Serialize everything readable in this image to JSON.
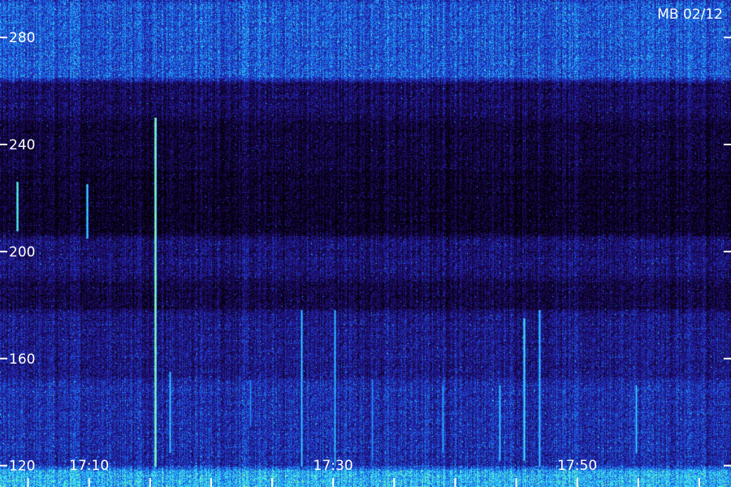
{
  "chart_data": {
    "type": "heatmap",
    "stamp": "MB 02/12",
    "y_axis": {
      "ticks": [
        120,
        160,
        200,
        240,
        280
      ],
      "range": [
        112,
        294
      ]
    },
    "x_axis": {
      "ticks": [
        "17:10",
        "17:30",
        "17:50"
      ],
      "tick_minutes": [
        10,
        30,
        50
      ],
      "range_minutes": [
        2.7,
        62.6
      ]
    },
    "colormap": [
      "#000000",
      "#14043a",
      "#22128a",
      "#1e3ed0",
      "#1a8ef0",
      "#3ee8f8",
      "#7cf7a0",
      "#f0f040"
    ],
    "bands": [
      {
        "from": 112,
        "to": 119,
        "level": 0.62
      },
      {
        "from": 119,
        "to": 152,
        "level": 0.36
      },
      {
        "from": 152,
        "to": 178,
        "level": 0.28
      },
      {
        "from": 178,
        "to": 190,
        "level": 0.16
      },
      {
        "from": 190,
        "to": 206,
        "level": 0.24
      },
      {
        "from": 206,
        "to": 230,
        "level": 0.09
      },
      {
        "from": 230,
        "to": 250,
        "level": 0.13
      },
      {
        "from": 250,
        "to": 264,
        "level": 0.2
      },
      {
        "from": 264,
        "to": 294,
        "level": 0.46
      }
    ],
    "bursts": [
      {
        "minute": 4.1,
        "from": 208,
        "to": 226,
        "level": 0.85
      },
      {
        "minute": 9.8,
        "from": 205,
        "to": 225,
        "level": 0.75
      },
      {
        "minute": 15.4,
        "from": 120,
        "to": 250,
        "level": 0.95
      },
      {
        "minute": 16.6,
        "from": 125,
        "to": 155,
        "level": 0.7
      },
      {
        "minute": 23.2,
        "from": 135,
        "to": 152,
        "level": 0.6
      },
      {
        "minute": 27.4,
        "from": 120,
        "to": 178,
        "level": 0.7
      },
      {
        "minute": 30.1,
        "from": 120,
        "to": 178,
        "level": 0.68
      },
      {
        "minute": 33.2,
        "from": 122,
        "to": 152,
        "level": 0.6
      },
      {
        "minute": 39.0,
        "from": 125,
        "to": 150,
        "level": 0.65
      },
      {
        "minute": 43.6,
        "from": 122,
        "to": 150,
        "level": 0.7
      },
      {
        "minute": 45.6,
        "from": 122,
        "to": 175,
        "level": 0.78
      },
      {
        "minute": 46.9,
        "from": 120,
        "to": 178,
        "level": 0.7
      },
      {
        "minute": 54.8,
        "from": 125,
        "to": 150,
        "level": 0.7
      }
    ]
  }
}
